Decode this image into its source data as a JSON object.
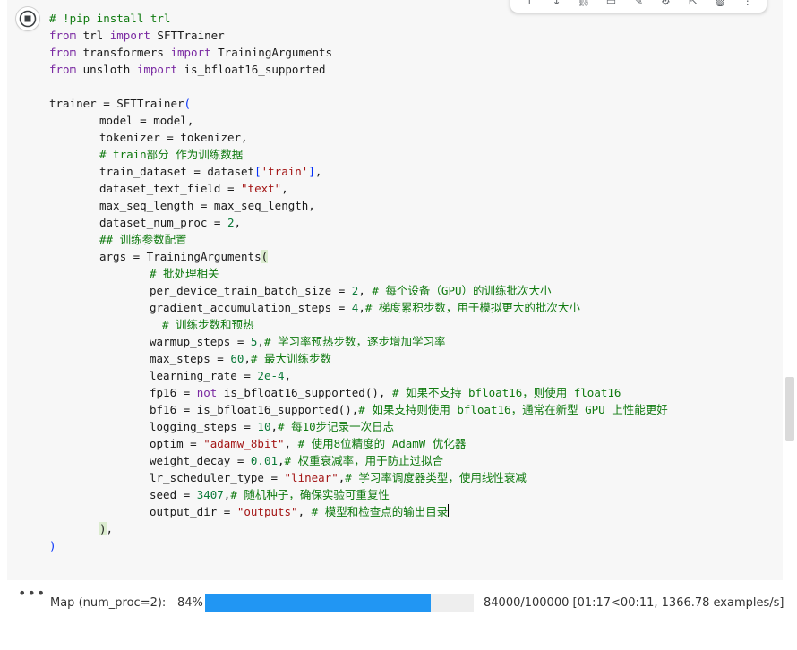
{
  "cell": {
    "code_lines": [
      "# !pip install trl",
      "from trl import SFTTrainer",
      "from transformers import TrainingArguments",
      "from unsloth import is_bfloat16_supported",
      "",
      "trainer = SFTTrainer(",
      "model = model,",
      "tokenizer = tokenizer,",
      "# train部分 作为训练数据",
      "train_dataset = dataset['train'],",
      "dataset_text_field = \"text\",",
      "max_seq_length = max_seq_length,",
      "dataset_num_proc = 2,",
      "## 训练参数配置",
      "args = TrainingArguments(",
      "# 批处理相关",
      "per_device_train_batch_size = 2, # 每个设备（GPU）的训练批次大小",
      "gradient_accumulation_steps = 4,# 梯度累积步数，用于模拟更大的批次大小",
      "# 训练步数和预热",
      "warmup_steps = 5,# 学习率预热步数，逐步增加学习率",
      "max_steps = 60,# 最大训练步数",
      "learning_rate = 2e-4,",
      "fp16 = not is_bfloat16_supported(), # 如果不支持 bfloat16，则使用 float16",
      "bf16 = is_bfloat16_supported(),# 如果支持则使用 bfloat16，通常在新型 GPU 上性能更好",
      "logging_steps = 10,# 每10步记录一次日志",
      "optim = \"adamw_8bit\", # 使用8位精度的 AdamW 优化器",
      "weight_decay = 0.01,# 权重衰减率，用于防止过拟合",
      "lr_scheduler_type = \"linear\",# 学习率调度器类型，使用线性衰减",
      "seed = 3407,# 随机种子，确保实验可重复性",
      "output_dir = \"outputs\", # 模型和检查点的输出目录",
      "),",
      ")"
    ]
  },
  "output": {
    "label": "Map (num_proc=2):",
    "percent_text": "84%",
    "progress_fraction": 0.84,
    "stats": "84000/100000 [01:17<00:11, 1366.78 examples/s]"
  },
  "toolbar": {
    "icons": [
      "arrow-up-icon",
      "arrow-down-icon",
      "link-icon",
      "comment-icon",
      "edit-icon",
      "gear-icon",
      "external-icon",
      "delete-icon",
      "more-icon"
    ]
  },
  "colors": {
    "keyword": "#7928a1",
    "string": "#a31515",
    "number": "#0c7a3a",
    "comment": "#0f7a0f",
    "progress": "#2196f3"
  }
}
